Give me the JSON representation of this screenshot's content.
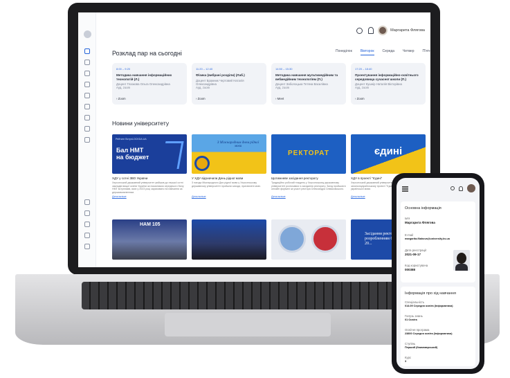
{
  "header": {
    "user_name": "Маргарита Флягова"
  },
  "schedule": {
    "title": "Розклад пар на сьогодні",
    "tabs": [
      "Понеділок",
      "Вівторок",
      "Середа",
      "Четвер",
      "П'ятниця"
    ],
    "active_tab": "Вівторок",
    "lessons": [
      {
        "time": "8:00 – 9:20",
        "name": "Методика навчання інформаційних технологій (Л.)",
        "teacher": "Доцент Глазкова Ольга Олександрівна",
        "room": "Ауд. zoom",
        "link": "Zoom"
      },
      {
        "time": "11:20 – 12:40",
        "name": "Фізика (вибрані розділи) (Лаб.)",
        "teacher": "Доцент Бражник Чертовий Наталія Олександрівна",
        "room": "Ауд. zoom",
        "link": "Zoom"
      },
      {
        "time": "14:50 – 15:30",
        "name": "Методика навчання мультимедійним та вебмедійним технологіям (П.)",
        "teacher": "Доцент Заболоцька Тетяна Василівна",
        "room": "Ауд. zoom",
        "link": "Meet"
      },
      {
        "time": "17:20 – 18:40",
        "name": "Проектування інформаційно-освітнього середовища сучасної школи (П.)",
        "teacher": "Доцент Кушнір Наталія Вікторівна",
        "room": "Ауд. zoom",
        "link": "Zoom"
      }
    ]
  },
  "news": {
    "title": "Новини університету",
    "items": [
      {
        "image_text": "Бал НМТ на бюджет",
        "image_caption": "Рейтинг ВступLOCKDA.UA",
        "headline": "ХДУ у сотні ЗВО України",
        "desc": "Херсонський державний університет увійшов до першої сотні закладів вищої освіти України за показником середнього балу НМТ вступників, яких у 2023 році зараховано на навчання за держзамовленням.",
        "more": "Детальніше"
      },
      {
        "image_text": "З Міжнародним днем рідної мови",
        "image_caption": "",
        "headline": "У ХДУ відзначили День рідної мови",
        "desc": "З нагоди Міжнародного Дня рідної мови у Херсонському державному університеті пройшли заходи, присвячені мові.",
        "more": "Детальніше"
      },
      {
        "image_text": "РЕКТОРАТ",
        "image_caption": "",
        "headline": "Щотижневе засідання ректорату",
        "desc": "Традиційно робочий тиждень у Херсонському державному університеті розпочався із засідання ректорату. Захід пройшов в онлайн форматі за участі ректора Олександра Співаковського.",
        "more": "Детальніше"
      },
      {
        "image_text": "єдині",
        "image_caption": "",
        "headline": "ХДУ в проекті \"Єдині\"",
        "desc": "Херсонський державний університет взяв участь у загальноукраїнському проекті \"Єдині\" з безкоштовного вивчення української мови.",
        "more": "Детальніше"
      }
    ],
    "second_row": [
      {
        "image_text": "НАМ 105"
      },
      {
        "image_text": ""
      },
      {
        "image_text": ""
      },
      {
        "image_text": "Засідання ректорату з розробленням Стратегії на 2021-20..."
      }
    ]
  },
  "phone": {
    "basic_title": "Основна інформація",
    "fields": [
      {
        "label": "Ім'я",
        "value": "Маргарита Флягова"
      },
      {
        "label": "E-mail",
        "value": "margarita.fliahova@university.ks.ua"
      },
      {
        "label": "Дата реєстрації",
        "value": "2021-09-17"
      },
      {
        "label": "Код користувача",
        "value": "000388"
      }
    ],
    "study_title": "Інформація про хід навчання",
    "study_fields": [
      {
        "label": "Спеціальність",
        "value": "014.09 Середня освіта (Інформатика)"
      },
      {
        "label": "Галузь знань",
        "value": "01 Освіта"
      },
      {
        "label": "Освітня програма",
        "value": "23800 Середня освіта (Інформатика)"
      },
      {
        "label": "Ступінь",
        "value": "Перший (бакалаврський)"
      },
      {
        "label": "Курс",
        "value": "3"
      }
    ]
  },
  "colors": {
    "accent": "#2463d9",
    "news_blue": "#1d4aa8",
    "news_yellow": "#f2c318"
  }
}
